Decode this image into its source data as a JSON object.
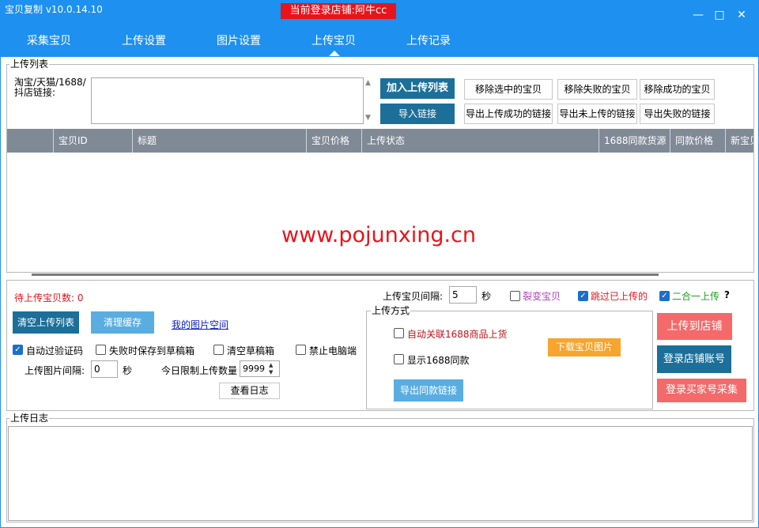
{
  "window": {
    "title": "宝贝复制  v10.0.14.10",
    "shop_banner": "当前登录店铺:阿牛cc",
    "controls": {
      "minimize": "—",
      "maximize": "□",
      "close": "✕"
    }
  },
  "nav": {
    "tabs": [
      {
        "label": "采集宝贝"
      },
      {
        "label": "上传设置"
      },
      {
        "label": "图片设置"
      },
      {
        "label": "上传宝贝",
        "active": true
      },
      {
        "label": "上传记录"
      }
    ]
  },
  "upload_list": {
    "title": "上传列表",
    "link_label": "淘宝/天猫/1688/抖店链接:",
    "link_value": "",
    "add_button": "加入上传列表",
    "import_button": "导入链接",
    "remove_selected": "移除选中的宝贝",
    "remove_failed": "移除失败的宝贝",
    "remove_success": "移除成功的宝贝",
    "export_success": "导出上传成功的链接",
    "export_not_uploaded": "导出未上传的链接",
    "export_failed": "导出失败的链接",
    "columns": [
      "",
      "宝贝ID",
      "标题",
      "宝贝价格",
      "上传状态",
      "1688同款货源",
      "同款价格",
      "新宝贝"
    ],
    "rows": [],
    "watermark": "www.pojunxing.cn"
  },
  "settings": {
    "pending_count_label": "待上传宝贝数: 0",
    "interval_label": "上传宝贝间隔:",
    "interval_value": "5",
    "interval_unit": "秒",
    "split_label": "裂变宝贝",
    "skip_label": "跳过已上传的",
    "two_in_one_label": "二合一上传",
    "help": "?",
    "clear_list": "清空上传列表",
    "clear_cache": "清理缓存",
    "my_image_space": "我的图片空间",
    "auto_captcha": "自动过验证码",
    "save_draft_on_fail": "失败时保存到草稿箱",
    "clear_drafts": "清空草稿箱",
    "disable_pc": "禁止电脑端",
    "image_interval_label": "上传图片间隔:",
    "image_interval_value": "0",
    "image_interval_unit": "秒",
    "daily_limit_label": "今日限制上传数量",
    "daily_limit_value": "9999",
    "view_log": "查看日志",
    "method": {
      "title": "上传方式",
      "auto_link_1688": "自动关联1688商品上货",
      "show_1688": "显示1688同款",
      "download_images": "下载宝贝图片",
      "export_same": "导出同款链接"
    },
    "upload_to_shop": "上传到店铺",
    "login_shop": "登录店铺账号",
    "login_buyer": "登录买家号采集"
  },
  "log": {
    "title": "上传日志",
    "content": ""
  },
  "colors": {
    "titlebar": "#1e90f0",
    "banner": "#e8141b",
    "teal_button": "#1c6f99",
    "light_button": "#5aade0",
    "orange_button": "#f7a52f",
    "red_button": "#f46a6a",
    "grid_header": "#808a96",
    "pending_red": "#e8141b",
    "split_purple": "#b040c0",
    "skip_red": "#e8141b",
    "two_in_one_green": "#1aa01a",
    "link_blue": "#1020c0"
  }
}
